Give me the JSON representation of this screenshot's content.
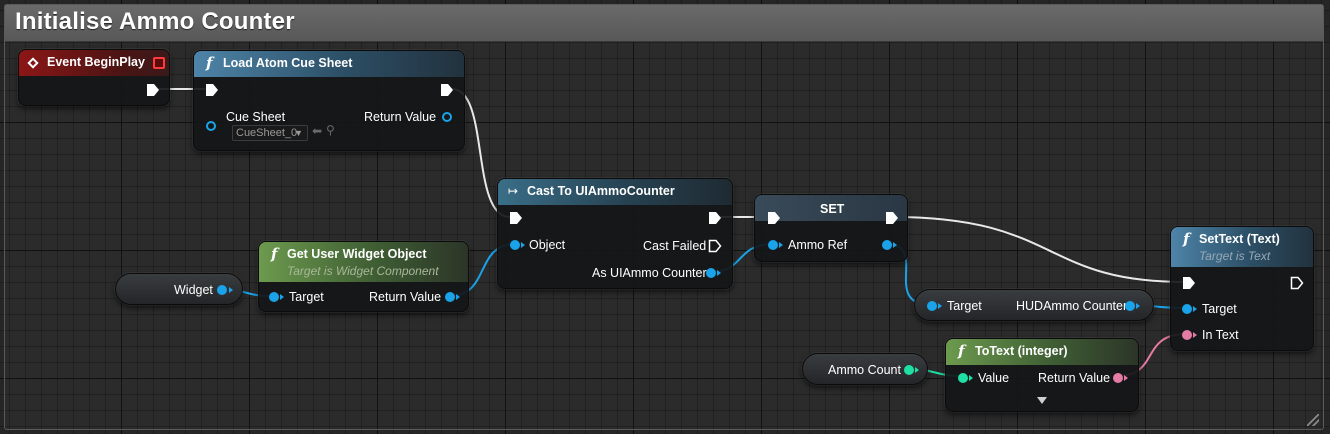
{
  "comment": {
    "title": "Initialise Ammo Counter"
  },
  "colors": {
    "object_pin": "#1aa3e8",
    "integer_pin": "#1fe0a4",
    "text_pin": "#e57ca3",
    "exec_pin": "#ffffff",
    "event_header": "#8c1616",
    "function_header": "#4e84a8",
    "pure_header": "#6c9a4e"
  },
  "nodes": {
    "event_begin_play": {
      "title": "Event BeginPlay",
      "icon": "event-diamond-icon"
    },
    "load_atom_cue_sheet": {
      "title": "Load Atom Cue Sheet",
      "icon": "function-icon",
      "pins": {
        "cue_sheet": "Cue Sheet",
        "return_value": "Return Value"
      },
      "cue_sheet_value": "CueSheet_0"
    },
    "widget_var": {
      "label": "Widget"
    },
    "get_user_widget_object": {
      "title": "Get User Widget Object",
      "subtitle": "Target is Widget Component",
      "pins": {
        "target": "Target",
        "return_value": "Return Value"
      }
    },
    "cast_to": {
      "title": "Cast To UIAmmoCounter",
      "pins": {
        "object": "Object",
        "cast_failed": "Cast Failed",
        "as": "As UIAmmo Counter"
      }
    },
    "set_node": {
      "title": "SET",
      "pins": {
        "ammo_ref": "Ammo Ref"
      }
    },
    "hud_var": {
      "target": "Target",
      "label": "HUDAmmo Counter"
    },
    "ammo_count_var": {
      "label": "Ammo Count"
    },
    "to_text": {
      "title": "ToText (integer)",
      "pins": {
        "value": "Value",
        "return_value": "Return Value"
      }
    },
    "set_text": {
      "title": "SetText (Text)",
      "subtitle": "Target is Text",
      "pins": {
        "target": "Target",
        "in_text": "In Text"
      }
    }
  }
}
